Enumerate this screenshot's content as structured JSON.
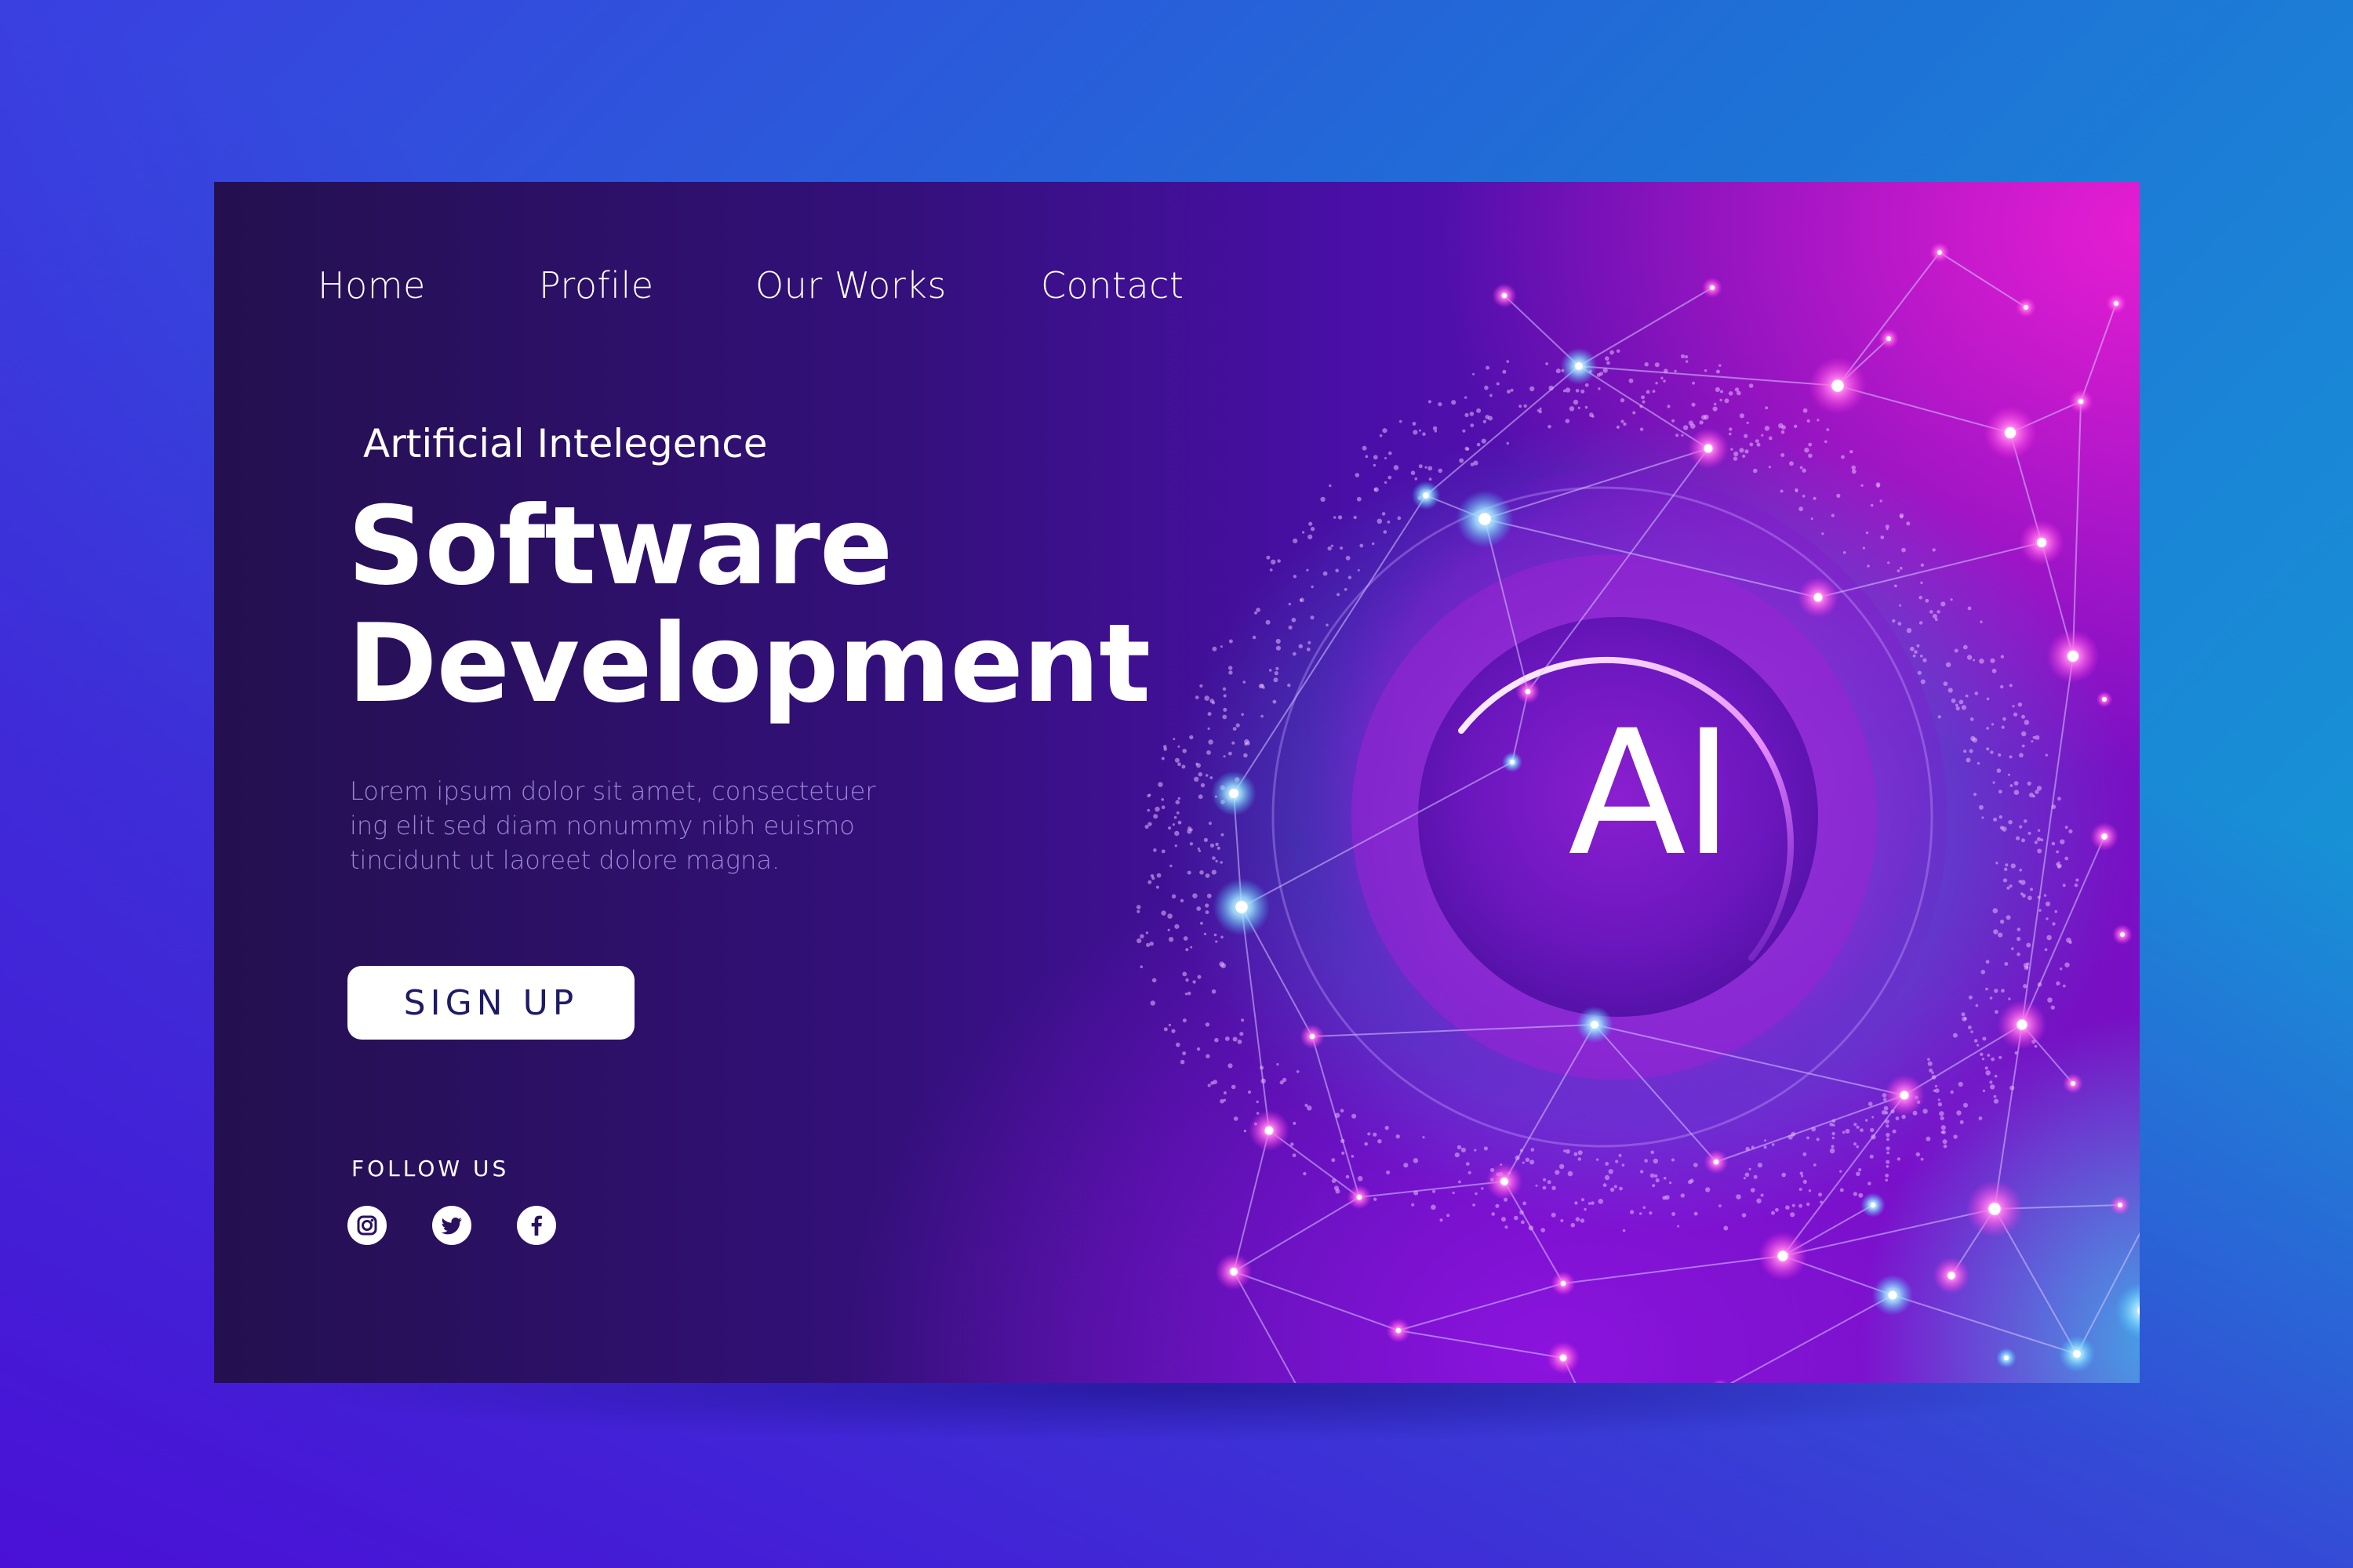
{
  "nav": {
    "items": [
      {
        "label": "Home"
      },
      {
        "label": "Profile"
      },
      {
        "label": "Our Works"
      },
      {
        "label": "Contact"
      }
    ]
  },
  "hero": {
    "eyebrow": "Artificial Intelegence",
    "headline_line1": "Software",
    "headline_line2": "Development",
    "body_line1": "Lorem ipsum dolor sit amet, consectetuer",
    "body_line2": "ing elit sed diam nonummy nibh euismo",
    "body_line3": "tincidunt ut laoreet dolore magna.",
    "cta_label": "SIGN UP"
  },
  "social": {
    "heading": "FOLLOW US",
    "icons": [
      "instagram-icon",
      "twitter-icon",
      "facebook-icon"
    ]
  },
  "graphic": {
    "badge_text": "AI"
  },
  "colors": {
    "card_dark": "#24104f",
    "accent_magenta": "#ec1ed2",
    "accent_cyan": "#3cbee9",
    "body_text": "#9b86d4",
    "button_text": "#1e1b66"
  }
}
